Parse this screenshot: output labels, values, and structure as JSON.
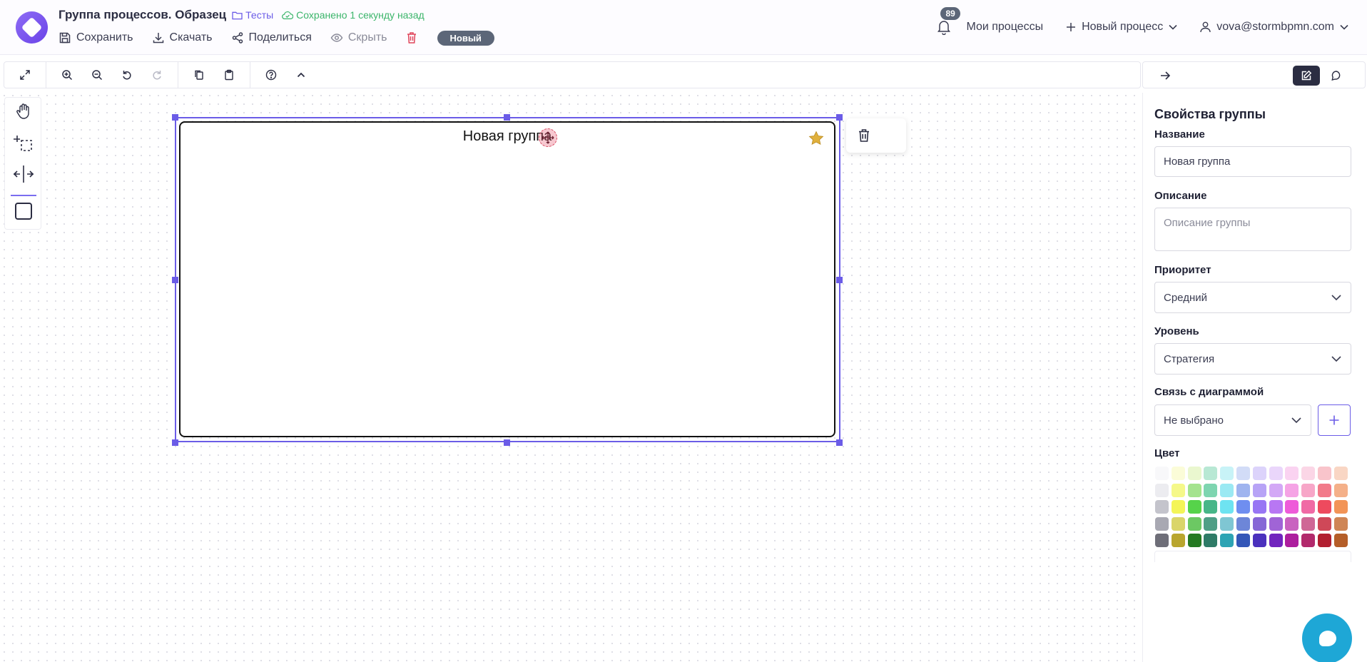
{
  "header": {
    "title": "Группа процессов. Образец",
    "folder": "Тесты",
    "saved_status": "Сохранено 1 секунду назад",
    "actions": {
      "save": "Сохранить",
      "download": "Скачать",
      "share": "Поделиться",
      "hide": "Скрыть"
    },
    "status_badge": "Новый",
    "notifications_count": "89",
    "my_processes": "Мои процессы",
    "new_process": "Новый процесс",
    "user_email": "vova@stormbpmn.com"
  },
  "canvas": {
    "group_label": "Новая группа"
  },
  "panel": {
    "title": "Свойства группы",
    "name_label": "Название",
    "name_value": "Новая группа",
    "description_label": "Описание",
    "description_placeholder": "Описание группы",
    "priority_label": "Приоритет",
    "priority_value": "Средний",
    "level_label": "Уровень",
    "level_value": "Стратегия",
    "diagram_link_label": "Связь с диаграммой",
    "diagram_link_value": "Не выбрано",
    "color_label": "Цвет",
    "palette": [
      "#f8f8fa",
      "#fbfcd8",
      "#eaf7cf",
      "#b8e8d4",
      "#c8f3f7",
      "#d2dcf7",
      "#dcd3fb",
      "#ead6fb",
      "#fad3f1",
      "#fbd6e6",
      "#f9c4cb",
      "#f9d6c4",
      "#ececf0",
      "#f5f88a",
      "#a4e38e",
      "#7ed5b0",
      "#9be9f3",
      "#9fb4ef",
      "#b7a3f6",
      "#d3a8f6",
      "#f5a3e5",
      "#f7a6c8",
      "#f27a8a",
      "#f4b089",
      "#c4c4cc",
      "#f4f558",
      "#56d34a",
      "#47b688",
      "#6ee3f1",
      "#6f8ef0",
      "#9876f4",
      "#b877f3",
      "#ee5bd9",
      "#f06aa5",
      "#ee4a5e",
      "#f29457",
      "#a8a8b2",
      "#dad56a",
      "#6cc863",
      "#4f9f86",
      "#7fc6d3",
      "#6d86d8",
      "#8667d6",
      "#a064d6",
      "#c962c0",
      "#cf6796",
      "#cf4858",
      "#cf8555",
      "#6e6e78",
      "#b9a62e",
      "#257a22",
      "#2f7b67",
      "#2ea4b4",
      "#3457b8",
      "#4b31bd",
      "#7124be",
      "#ad1e9e",
      "#b22a6c",
      "#b21f30",
      "#b55e28"
    ]
  },
  "colors": {
    "accent": "#6b5ce7",
    "success": "#3bb56a",
    "danger": "#e0445a",
    "badge": "#5c6678"
  }
}
